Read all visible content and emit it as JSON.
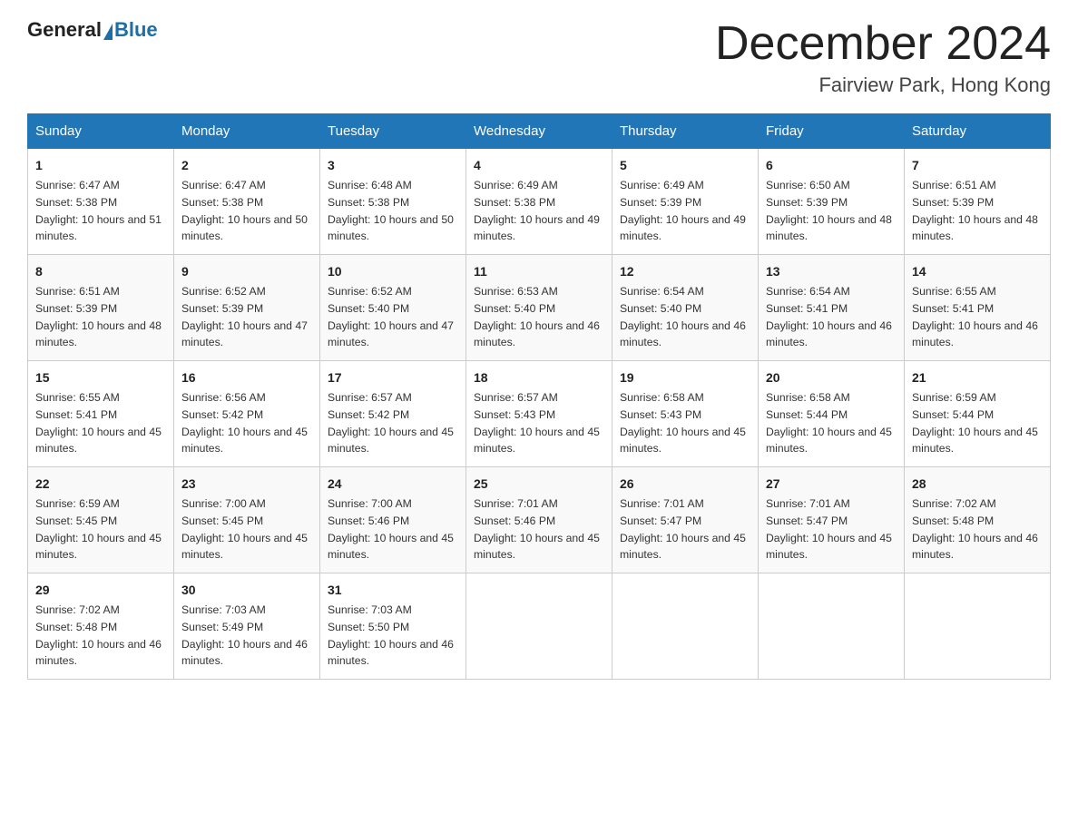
{
  "header": {
    "logo_general": "General",
    "logo_blue": "Blue",
    "month_title": "December 2024",
    "location": "Fairview Park, Hong Kong"
  },
  "days_of_week": [
    "Sunday",
    "Monday",
    "Tuesday",
    "Wednesday",
    "Thursday",
    "Friday",
    "Saturday"
  ],
  "weeks": [
    [
      {
        "num": "1",
        "sunrise": "6:47 AM",
        "sunset": "5:38 PM",
        "daylight": "10 hours and 51 minutes."
      },
      {
        "num": "2",
        "sunrise": "6:47 AM",
        "sunset": "5:38 PM",
        "daylight": "10 hours and 50 minutes."
      },
      {
        "num": "3",
        "sunrise": "6:48 AM",
        "sunset": "5:38 PM",
        "daylight": "10 hours and 50 minutes."
      },
      {
        "num": "4",
        "sunrise": "6:49 AM",
        "sunset": "5:38 PM",
        "daylight": "10 hours and 49 minutes."
      },
      {
        "num": "5",
        "sunrise": "6:49 AM",
        "sunset": "5:39 PM",
        "daylight": "10 hours and 49 minutes."
      },
      {
        "num": "6",
        "sunrise": "6:50 AM",
        "sunset": "5:39 PM",
        "daylight": "10 hours and 48 minutes."
      },
      {
        "num": "7",
        "sunrise": "6:51 AM",
        "sunset": "5:39 PM",
        "daylight": "10 hours and 48 minutes."
      }
    ],
    [
      {
        "num": "8",
        "sunrise": "6:51 AM",
        "sunset": "5:39 PM",
        "daylight": "10 hours and 48 minutes."
      },
      {
        "num": "9",
        "sunrise": "6:52 AM",
        "sunset": "5:39 PM",
        "daylight": "10 hours and 47 minutes."
      },
      {
        "num": "10",
        "sunrise": "6:52 AM",
        "sunset": "5:40 PM",
        "daylight": "10 hours and 47 minutes."
      },
      {
        "num": "11",
        "sunrise": "6:53 AM",
        "sunset": "5:40 PM",
        "daylight": "10 hours and 46 minutes."
      },
      {
        "num": "12",
        "sunrise": "6:54 AM",
        "sunset": "5:40 PM",
        "daylight": "10 hours and 46 minutes."
      },
      {
        "num": "13",
        "sunrise": "6:54 AM",
        "sunset": "5:41 PM",
        "daylight": "10 hours and 46 minutes."
      },
      {
        "num": "14",
        "sunrise": "6:55 AM",
        "sunset": "5:41 PM",
        "daylight": "10 hours and 46 minutes."
      }
    ],
    [
      {
        "num": "15",
        "sunrise": "6:55 AM",
        "sunset": "5:41 PM",
        "daylight": "10 hours and 45 minutes."
      },
      {
        "num": "16",
        "sunrise": "6:56 AM",
        "sunset": "5:42 PM",
        "daylight": "10 hours and 45 minutes."
      },
      {
        "num": "17",
        "sunrise": "6:57 AM",
        "sunset": "5:42 PM",
        "daylight": "10 hours and 45 minutes."
      },
      {
        "num": "18",
        "sunrise": "6:57 AM",
        "sunset": "5:43 PM",
        "daylight": "10 hours and 45 minutes."
      },
      {
        "num": "19",
        "sunrise": "6:58 AM",
        "sunset": "5:43 PM",
        "daylight": "10 hours and 45 minutes."
      },
      {
        "num": "20",
        "sunrise": "6:58 AM",
        "sunset": "5:44 PM",
        "daylight": "10 hours and 45 minutes."
      },
      {
        "num": "21",
        "sunrise": "6:59 AM",
        "sunset": "5:44 PM",
        "daylight": "10 hours and 45 minutes."
      }
    ],
    [
      {
        "num": "22",
        "sunrise": "6:59 AM",
        "sunset": "5:45 PM",
        "daylight": "10 hours and 45 minutes."
      },
      {
        "num": "23",
        "sunrise": "7:00 AM",
        "sunset": "5:45 PM",
        "daylight": "10 hours and 45 minutes."
      },
      {
        "num": "24",
        "sunrise": "7:00 AM",
        "sunset": "5:46 PM",
        "daylight": "10 hours and 45 minutes."
      },
      {
        "num": "25",
        "sunrise": "7:01 AM",
        "sunset": "5:46 PM",
        "daylight": "10 hours and 45 minutes."
      },
      {
        "num": "26",
        "sunrise": "7:01 AM",
        "sunset": "5:47 PM",
        "daylight": "10 hours and 45 minutes."
      },
      {
        "num": "27",
        "sunrise": "7:01 AM",
        "sunset": "5:47 PM",
        "daylight": "10 hours and 45 minutes."
      },
      {
        "num": "28",
        "sunrise": "7:02 AM",
        "sunset": "5:48 PM",
        "daylight": "10 hours and 46 minutes."
      }
    ],
    [
      {
        "num": "29",
        "sunrise": "7:02 AM",
        "sunset": "5:48 PM",
        "daylight": "10 hours and 46 minutes."
      },
      {
        "num": "30",
        "sunrise": "7:03 AM",
        "sunset": "5:49 PM",
        "daylight": "10 hours and 46 minutes."
      },
      {
        "num": "31",
        "sunrise": "7:03 AM",
        "sunset": "5:50 PM",
        "daylight": "10 hours and 46 minutes."
      },
      null,
      null,
      null,
      null
    ]
  ]
}
